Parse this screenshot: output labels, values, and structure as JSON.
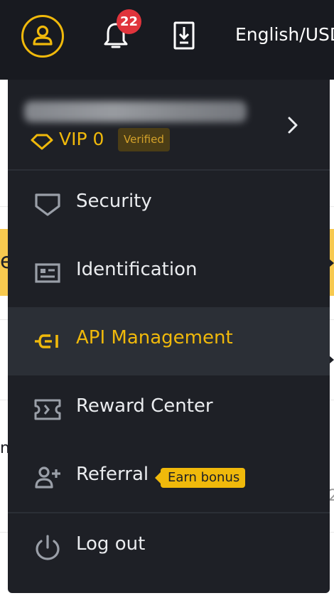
{
  "header": {
    "notification_count": "22",
    "language": "English/USD"
  },
  "account": {
    "vip_level": "VIP 0",
    "verified_badge": "Verified"
  },
  "menu": {
    "items": [
      {
        "label": "Security",
        "icon": "shield-icon"
      },
      {
        "label": "Identification",
        "icon": "id-card-icon"
      },
      {
        "label": "API Management",
        "icon": "api-key-icon",
        "active": true
      },
      {
        "label": "Reward Center",
        "icon": "ticket-icon"
      },
      {
        "label": "Referral",
        "icon": "add-user-icon",
        "badge": "Earn bonus"
      },
      {
        "label": "Log out",
        "icon": "power-icon"
      }
    ]
  },
  "colors": {
    "accent": "#f0b90b",
    "panel_background": "#1e2026",
    "topbar_background": "#181a20",
    "active_row": "#2b2f36",
    "notification_badge": "#e0343c"
  }
}
